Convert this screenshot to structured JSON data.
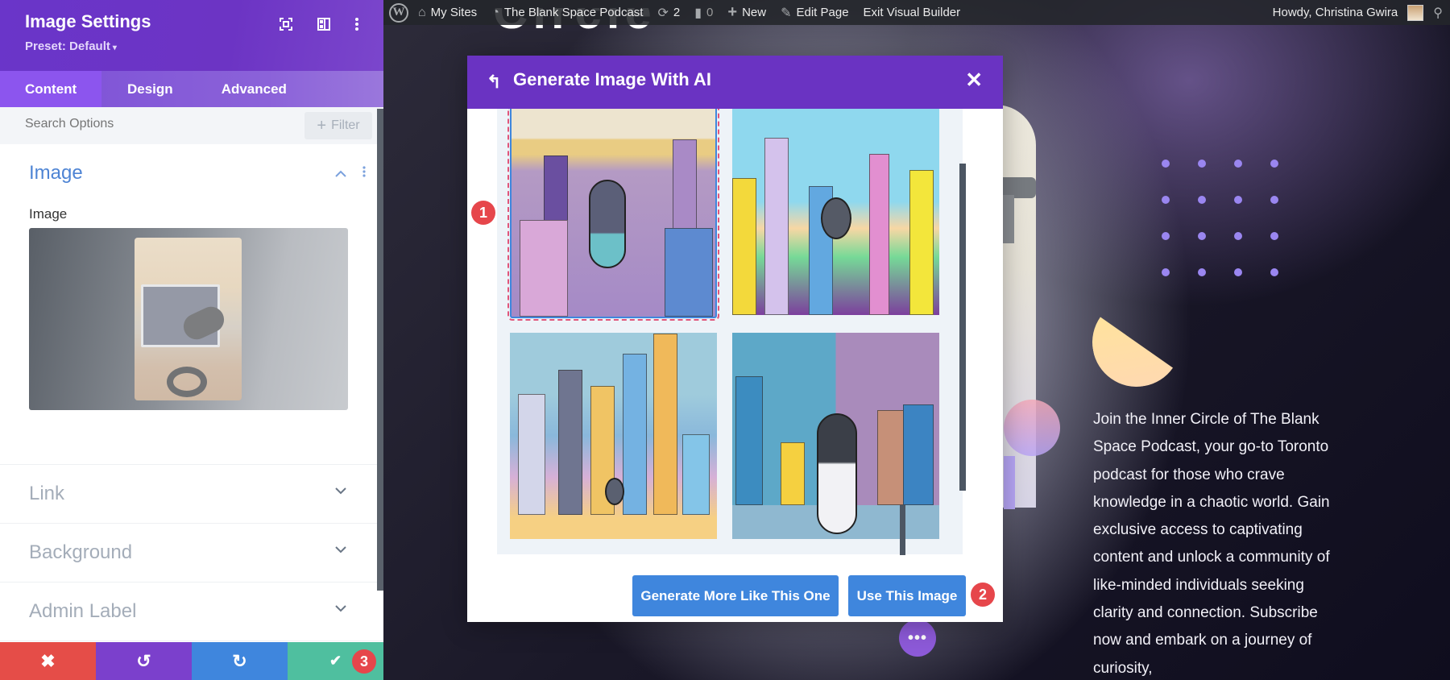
{
  "settings_panel": {
    "title": "Image Settings",
    "preset": "Preset: Default",
    "preset_caret": "▾",
    "header_icons": [
      "focus-icon",
      "sidebar-layout-icon",
      "more-vertical-icon"
    ],
    "tabs": [
      {
        "label": "Content",
        "active": true
      },
      {
        "label": "Design",
        "active": false
      },
      {
        "label": "Advanced",
        "active": false
      }
    ],
    "search_placeholder": "Search Options",
    "filter_label": "Filter",
    "filter_icon": "+",
    "sections": {
      "image": {
        "title": "Image",
        "expanded": true,
        "field_label": "Image"
      },
      "link": {
        "title": "Link",
        "expanded": false
      },
      "background": {
        "title": "Background",
        "expanded": false
      },
      "admin_label": {
        "title": "Admin Label",
        "expanded": false
      }
    },
    "footer": {
      "cancel_glyph": "✖",
      "undo_glyph": "↺",
      "redo_glyph": "↻",
      "save_glyph": "✔",
      "save_step_badge": "3"
    }
  },
  "admin_bar": {
    "wp_logo": "W",
    "my_sites": "My Sites",
    "site_name": "The Blank Space Podcast",
    "updates_count": "2",
    "comments_count": "0",
    "new_label": "New",
    "edit_page": "Edit Page",
    "exit_builder": "Exit Visual Builder",
    "greeting": "Howdy, Christina Gwira"
  },
  "modal": {
    "title": "Generate Image With AI",
    "back_glyph": "↰",
    "close_glyph": "✕",
    "images": [
      {
        "desc": "Retro microphone over purple city skyline",
        "selected": true
      },
      {
        "desc": "Pop-art microphone on rooftop with colorful skyline",
        "selected": false
      },
      {
        "desc": "Cartoon city skyline with small microphone",
        "selected": false
      },
      {
        "desc": "Microphone in front of city buildings on blue and purple background",
        "selected": false
      }
    ],
    "selected_step_badge": "1",
    "generate_more_label": "Generate More Like This One",
    "use_image_label": "Use This Image",
    "use_step_badge": "2"
  },
  "page": {
    "headline_fragment": "Circle",
    "body_text": "Join the Inner Circle of The Blank Space Podcast, your go-to Toronto podcast for those who crave knowledge in a chaotic world. Gain exclusive access to captivating content and unlock a community of like-minded individuals seeking clarity and connection. Subscribe now and embark on a journey of curiosity,",
    "more_glyph": "•••"
  },
  "colors": {
    "purple_header": "#6a33c2",
    "blue_button": "#3f86dd",
    "cancel_red": "#e54d48",
    "save_green": "#4fbf9f",
    "badge_red": "#e6464b",
    "section_blue": "#4e84d4"
  }
}
